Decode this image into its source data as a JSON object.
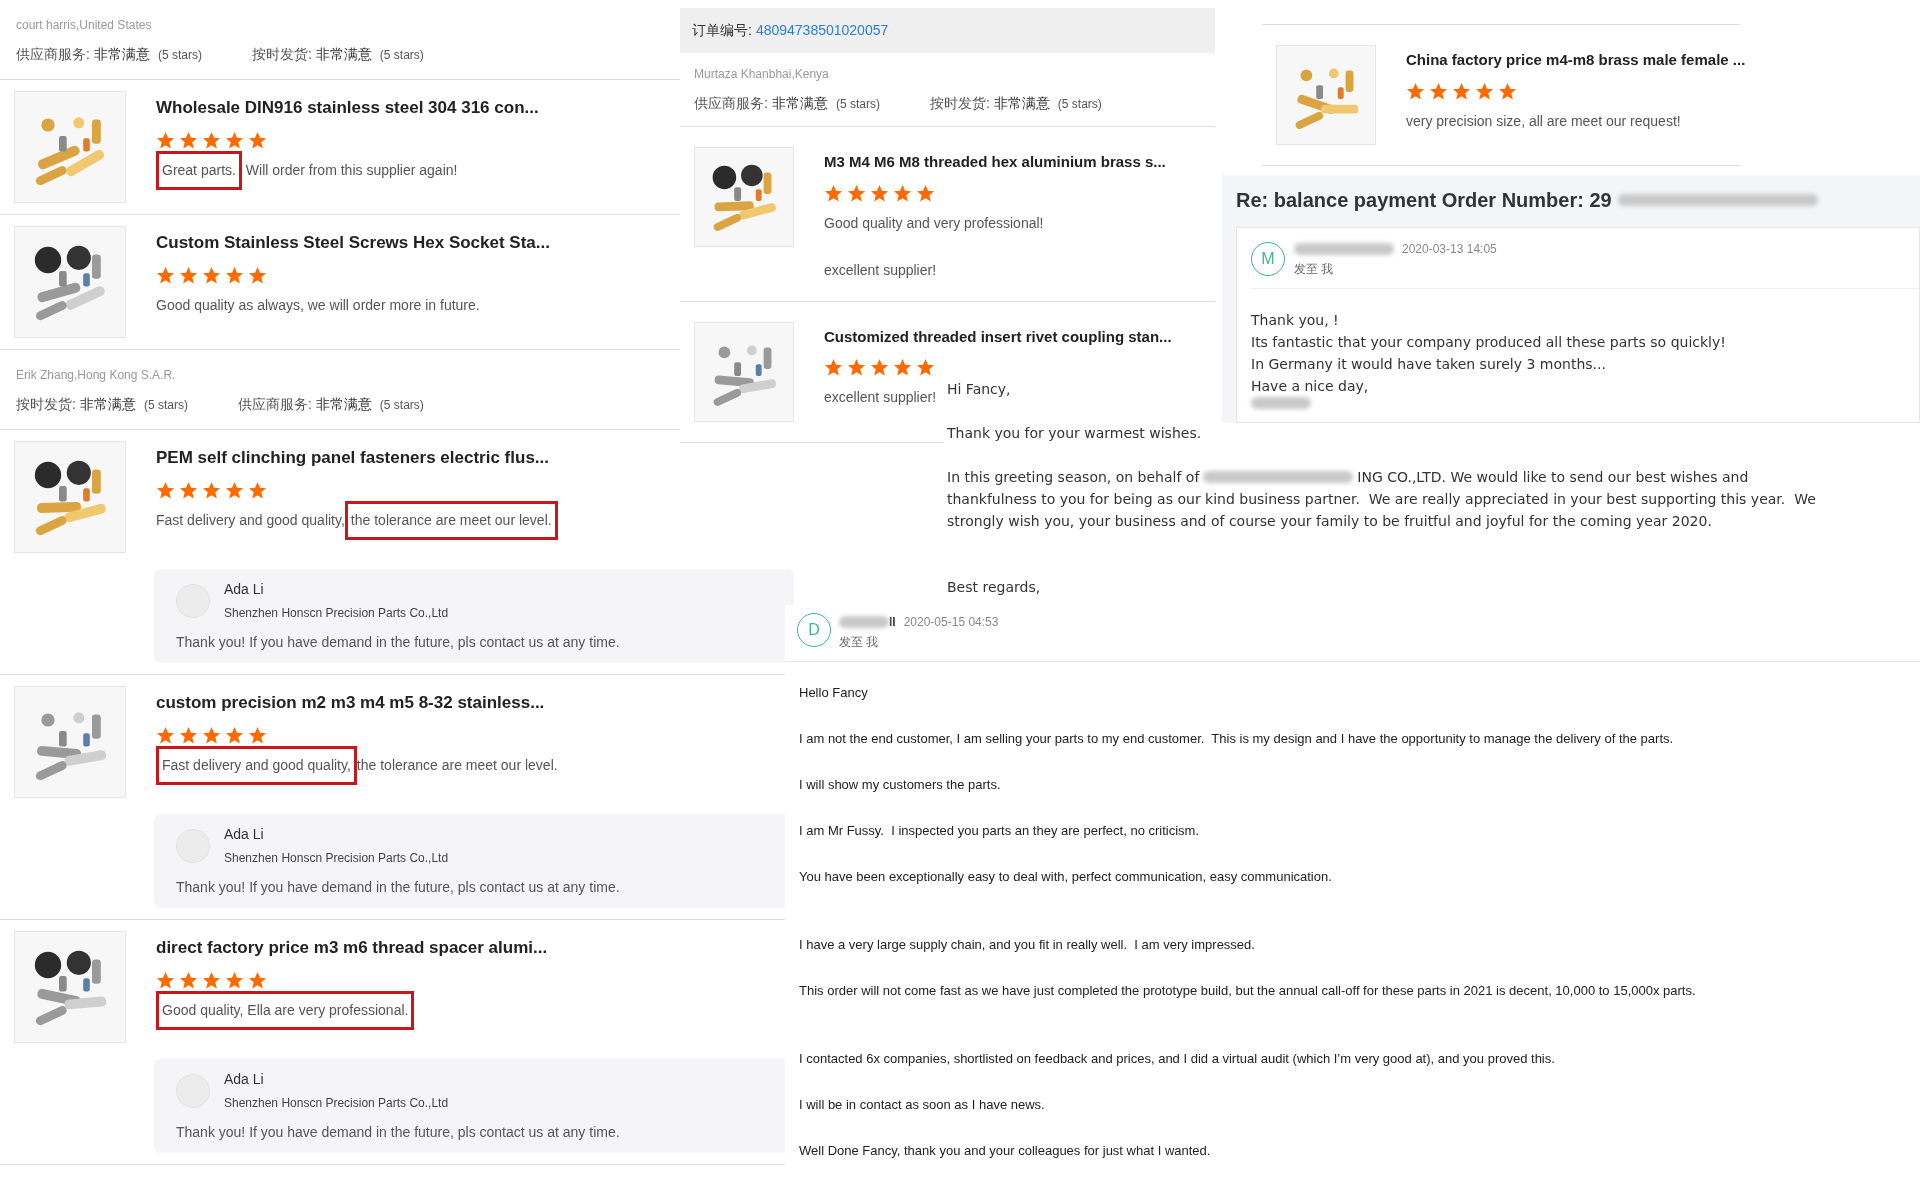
{
  "left_column": [
    {
      "kind": "buyer",
      "name": "court harris,United States",
      "ratings": [
        {
          "label": "供应商服务:",
          "value": "非常满意",
          "note": "(5 stars)"
        },
        {
          "label": "按时发货:",
          "value": "非常满意",
          "note": "(5 stars)"
        }
      ]
    },
    {
      "kind": "product",
      "title": "Wholesale DIN916 stainless steel 304 316 con...",
      "stars": 5,
      "comment": [
        {
          "text": "Great parts.",
          "highlighted": true
        },
        {
          "text": " Will order from this supplier again!",
          "highlighted": false
        }
      ]
    },
    {
      "kind": "product",
      "title": "Custom Stainless Steel Screws Hex Socket Sta...",
      "stars": 5,
      "comment": [
        {
          "text": "Good quality as always, we will order more in future.",
          "highlighted": false
        }
      ]
    },
    {
      "kind": "buyer",
      "name": "Erik Zhang,Hong Kong S.A.R.",
      "ratings": [
        {
          "label": "按时发货:",
          "value": "非常满意",
          "note": "(5 stars)"
        },
        {
          "label": "供应商服务:",
          "value": "非常满意",
          "note": "(5 stars)"
        }
      ]
    },
    {
      "kind": "product",
      "title": "PEM self clinching panel fasteners electric flus...",
      "stars": 5,
      "comment": [
        {
          "text": "Fast delivery and good quality,",
          "highlighted": false
        },
        {
          "text": "the tolerance are meet our level.",
          "highlighted": true
        }
      ],
      "reply": {
        "author": "Ada Li",
        "company": "Shenzhen Honscn Precision Parts Co.,Ltd",
        "text": "Thank you! If you have demand in the future, pls contact us at any time."
      }
    },
    {
      "kind": "product",
      "title": "custom precision m2 m3 m4 m5 8-32 stainless...",
      "stars": 5,
      "comment": [
        {
          "text": "Fast delivery and good quality,",
          "highlighted": true
        },
        {
          "text": "the tolerance are meet our level.",
          "highlighted": false
        }
      ],
      "reply": {
        "author": "Ada Li",
        "company": "Shenzhen Honscn Precision Parts Co.,Ltd",
        "text": "Thank you! If you have demand in the future, pls contact us at any time."
      }
    },
    {
      "kind": "product",
      "title": "direct factory price m3 m6 thread spacer alumi...",
      "stars": 5,
      "comment": [
        {
          "text": "Good quality, Ella are very professional.",
          "highlighted": true
        }
      ],
      "reply": {
        "author": "Ada Li",
        "company": "Shenzhen Honscn Precision Parts Co.,Ltd",
        "text": "Thank you! If you have demand in the future, pls contact us at any time."
      }
    }
  ],
  "order_panel": {
    "order_label": "订单编号:",
    "order_number": "48094738501020057",
    "blocks": [
      {
        "kind": "buyer",
        "name": "Murtaza Khanbhai,Kenya",
        "ratings": [
          {
            "label": "供应商服务:",
            "value": "非常满意",
            "note": "(5 stars)"
          },
          {
            "label": "按时发货:",
            "value": "非常满意",
            "note": "(5 stars)"
          }
        ]
      },
      {
        "kind": "product",
        "title": "M3 M4 M6 M8 threaded hex aluminium brass s...",
        "stars": 5,
        "comment": [
          {
            "text": "Good quality and very professional!",
            "highlighted": false
          }
        ],
        "extra_comment": "excellent supplier!"
      },
      {
        "kind": "product",
        "title": "Customized threaded insert rivet coupling stan...",
        "stars": 5,
        "comment": [
          {
            "text": "excellent supplier!",
            "highlighted": false
          }
        ]
      }
    ]
  },
  "top_right": {
    "blocks": [
      {
        "kind": "product",
        "title": "China factory price m4-m8 brass male female ...",
        "stars": 5,
        "comment": [
          {
            "text": "very precision size, all are meet our request!",
            "highlighted": false
          }
        ]
      }
    ]
  },
  "email_1": {
    "subject": "Re: balance payment Order Number: 29",
    "avatar_letter": "M",
    "date": "2020-03-13 14:05",
    "recipient": "发至 我",
    "lines": [
      "Thank you, !",
      "Its fantastic that your company produced all these parts so quickly!",
      "In Germany it would have taken surely 3 months...",
      "Have a nice day,"
    ]
  },
  "greeting_letter": {
    "greeting": "Hi Fancy,",
    "thanks": "Thank you for your warmest wishes.",
    "line_1_start": "In this greeting season, on behalf of",
    "line_1_end": "ING CO.,LTD. We would like to send our best wishes and",
    "line_2": "thankfulness to you for being as our kind business partner.  We are really appreciated in your best supporting this year.  We",
    "line_3": "strongly wish you, your business and of course your family to be fruitful and joyful for the coming year 2020.",
    "closing": "Best regards,"
  },
  "email_2": {
    "avatar_letter": "D",
    "sender_tail": "ll",
    "date": "2020-05-15 04:53",
    "recipient": "发至 我",
    "paragraphs": [
      "Hello Fancy",
      "I am not the end customer, I am selling your parts to my end customer.  This is my design and I have the opportunity to manage the delivery of the parts.",
      "I will show my customers the parts.",
      "I am Mr Fussy.  I inspected you parts an they are perfect, no criticism.",
      "You have been exceptionally easy to deal with, perfect communication, easy communication.",
      "I have a very large supply chain, and you fit in really well.  I am very impressed.",
      "This order will not come fast as we have just completed the prototype build, but the annual call-off for these parts in 2021 is decent, 10,000 to 15,000x parts.",
      "I contacted 6x companies, shortlisted on feedback and prices, and I did a virtual audit (which I’m very good at), and you proved this.",
      "I will be in contact as soon as I have news.",
      "Well Done Fancy, thank you and your colleagues for just what I wanted."
    ]
  }
}
